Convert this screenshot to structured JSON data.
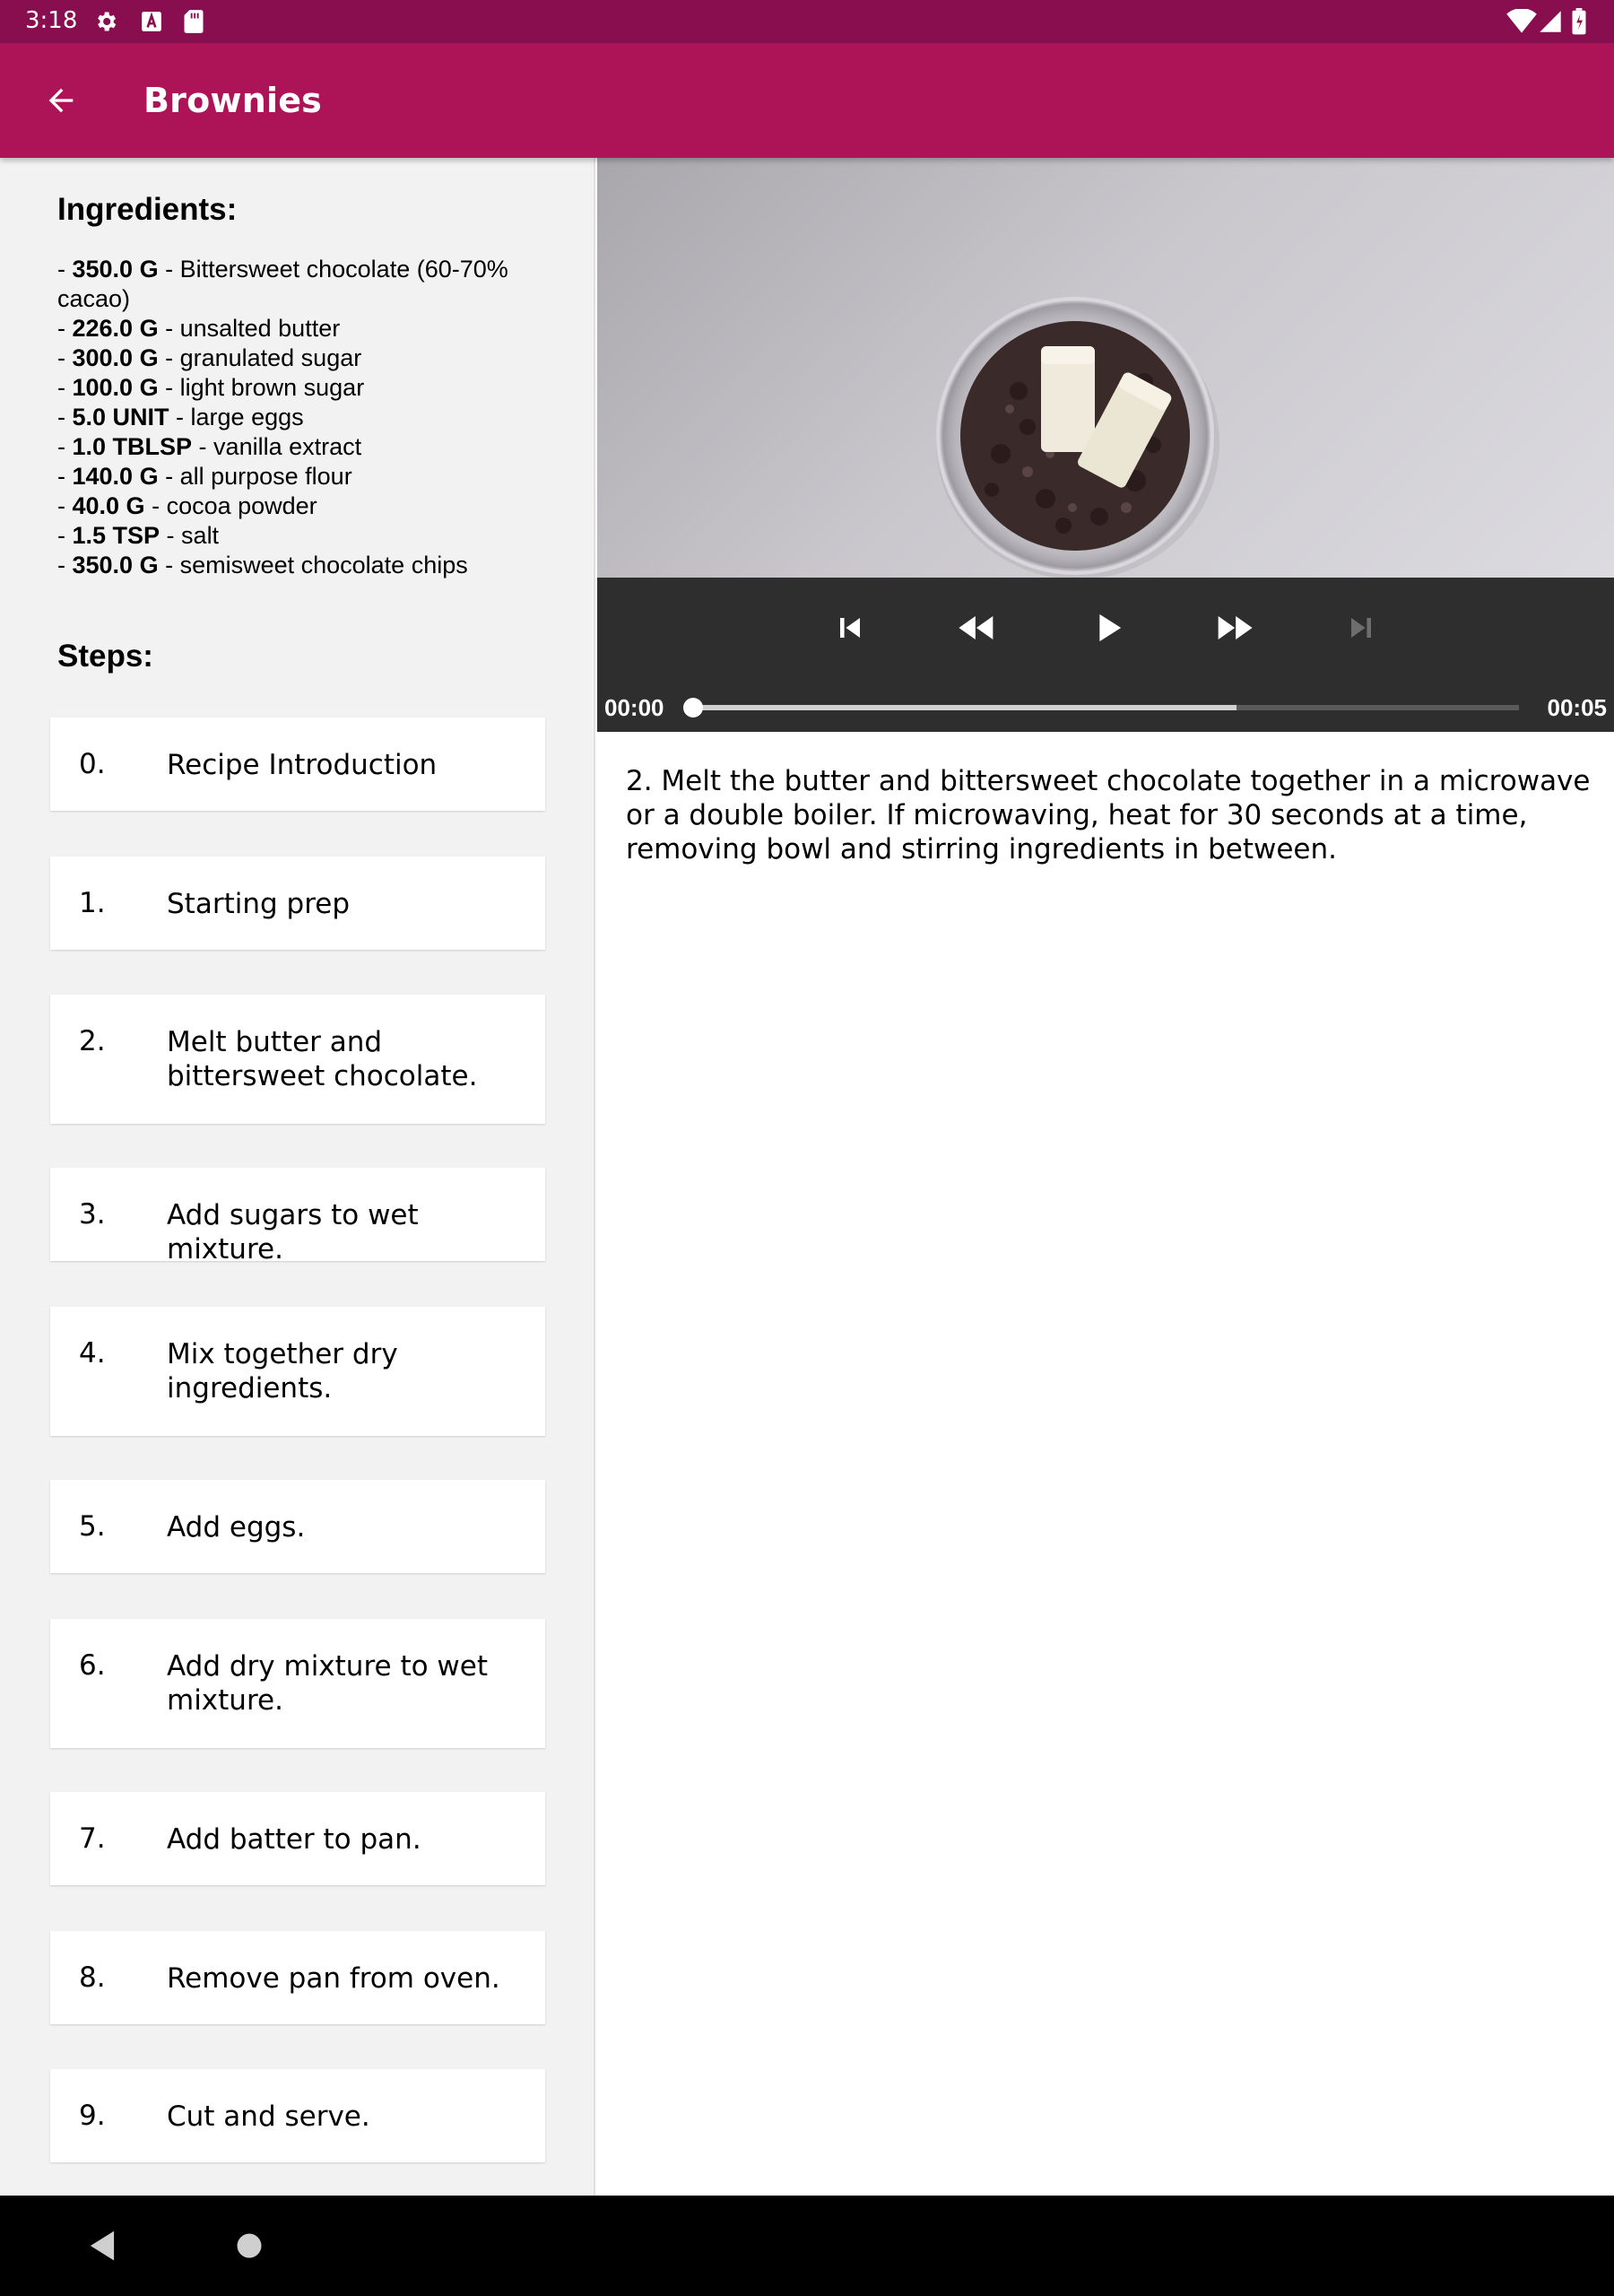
{
  "status_bar": {
    "time": "3:18"
  },
  "app_bar": {
    "title": "Brownies"
  },
  "ingredients": {
    "heading": "Ingredients:",
    "items": [
      {
        "qty": "350.0 G",
        "name": "Bittersweet chocolate (60-70% cacao)"
      },
      {
        "qty": "226.0 G",
        "name": "unsalted butter"
      },
      {
        "qty": "300.0 G",
        "name": "granulated sugar"
      },
      {
        "qty": "100.0 G",
        "name": "light brown sugar"
      },
      {
        "qty": "5.0 UNIT",
        "name": "large eggs"
      },
      {
        "qty": "1.0 TBLSP",
        "name": "vanilla extract"
      },
      {
        "qty": "140.0 G",
        "name": "all purpose flour"
      },
      {
        "qty": "40.0 G",
        "name": "cocoa powder"
      },
      {
        "qty": "1.5 TSP",
        "name": "salt"
      },
      {
        "qty": "350.0 G",
        "name": "semisweet chocolate chips"
      }
    ]
  },
  "steps": {
    "heading": "Steps:",
    "items": [
      {
        "num": "0.",
        "desc": "Recipe Introduction"
      },
      {
        "num": "1.",
        "desc": "Starting prep"
      },
      {
        "num": "2.",
        "desc": "Melt butter and bittersweet chocolate."
      },
      {
        "num": "3.",
        "desc": "Add sugars to wet mixture."
      },
      {
        "num": "4.",
        "desc": "Mix together dry ingredients."
      },
      {
        "num": "5.",
        "desc": "Add eggs."
      },
      {
        "num": "6.",
        "desc": "Add dry mixture to wet mixture."
      },
      {
        "num": "7.",
        "desc": "Add batter to pan."
      },
      {
        "num": "8.",
        "desc": "Remove pan from oven."
      },
      {
        "num": "9.",
        "desc": "Cut and serve."
      }
    ]
  },
  "player": {
    "position": "00:00",
    "duration": "00:05",
    "progress_fraction": 0.0,
    "buffered_fraction": 0.66,
    "controls": [
      "skip-previous-icon",
      "rewind-icon",
      "play-icon",
      "fast-forward-icon",
      "skip-next-icon"
    ]
  },
  "step_detail": {
    "description": "2. Melt the butter and bittersweet chocolate together in a microwave or a double boiler. If microwaving, heat for 30 seconds at a time, removing bowl and stirring ingredients in between."
  },
  "colors": {
    "status_bar": "#880e4f",
    "app_bar": "#ad1457",
    "accent_text": "#ffffff"
  }
}
